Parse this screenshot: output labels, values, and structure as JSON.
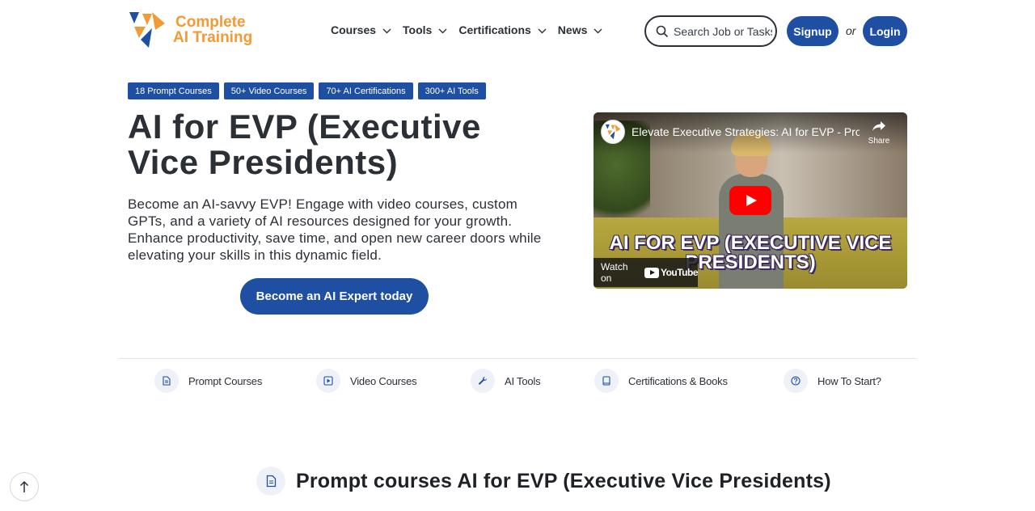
{
  "brand": {
    "line1": "Complete",
    "line2": "AI Training",
    "color": "#f29a36",
    "accent": "#1f4fa3"
  },
  "nav": [
    {
      "label": "Courses"
    },
    {
      "label": "Tools"
    },
    {
      "label": "Certifications"
    },
    {
      "label": "News"
    }
  ],
  "search": {
    "placeholder": "Search Job or Tasks"
  },
  "auth": {
    "signup": "Signup",
    "or": "or",
    "login": "Login"
  },
  "tags": [
    "18 Prompt Courses",
    "50+ Video Courses",
    "70+ AI Certifications",
    "300+ AI Tools"
  ],
  "hero": {
    "title": "AI for EVP (Executive Vice Presidents)",
    "description": "Become an AI-savvy EVP! Engage with video courses, custom GPTs, and a variety of AI resources designed for your growth. Enhance productivity, save time, and open new career doors while elevating your skills in this dynamic field.",
    "cta": "Become an AI Expert today"
  },
  "video": {
    "title": "Elevate Executive Strategies: AI for EVP - Pro...",
    "share": "Share",
    "overlay_line1": "AI FOR EVP (EXECUTIVE VICE",
    "overlay_line2": "PRESIDENTS)",
    "watch_on": "Watch on",
    "youtube": "YouTube"
  },
  "features": [
    {
      "label": "Prompt Courses",
      "icon": "document-icon"
    },
    {
      "label": "Video Courses",
      "icon": "play-icon"
    },
    {
      "label": "AI Tools",
      "icon": "wrench-icon"
    },
    {
      "label": "Certifications & Books",
      "icon": "book-icon"
    },
    {
      "label": "How To Start?",
      "icon": "question-icon"
    }
  ],
  "section": {
    "title": "Prompt courses AI for EVP (Executive Vice Presidents)"
  }
}
